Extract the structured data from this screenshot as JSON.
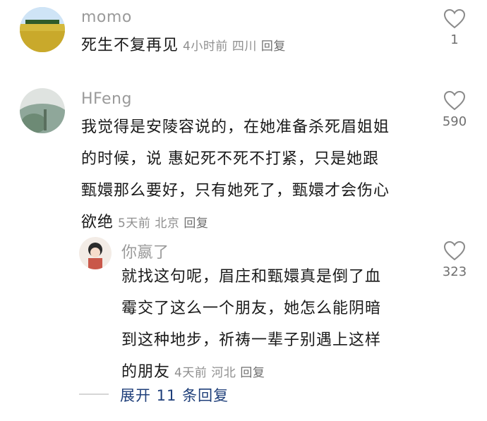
{
  "comments": [
    {
      "user": "momo",
      "text": "死生不复再见",
      "time": "4小时前",
      "location": "四川",
      "reply_label": "回复",
      "likes": "1",
      "like_icon": "heart-outline-icon"
    },
    {
      "user": "HFeng",
      "text_lines": [
        "我觉得是安陵容说的，在她准备杀死眉姐姐",
        "的时候，说 惠妃死不死不打紧，只是她跟",
        "甄嬛那么要好，只有她死了，甄嬛才会伤心",
        "欲绝"
      ],
      "time": "5天前",
      "location": "北京",
      "reply_label": "回复",
      "likes": "590",
      "like_icon": "heart-outline-icon"
    }
  ],
  "replies": [
    {
      "user": "你嬴了",
      "text_lines": [
        "就找这句呢，眉庄和甄嬛真是倒了血",
        "霉交了这么一个朋友，她怎么能阴暗",
        "到这种地步，祈祷一辈子别遇上这样",
        "的朋友"
      ],
      "time": "4天前",
      "location": "河北",
      "reply_label": "回复",
      "likes": "323",
      "like_icon": "heart-outline-icon"
    }
  ],
  "expand_replies": "展开 11 条回复",
  "colors": {
    "link": "#1f3f7a",
    "meta": "#8f8f8f",
    "text": "#1a1a1a"
  }
}
